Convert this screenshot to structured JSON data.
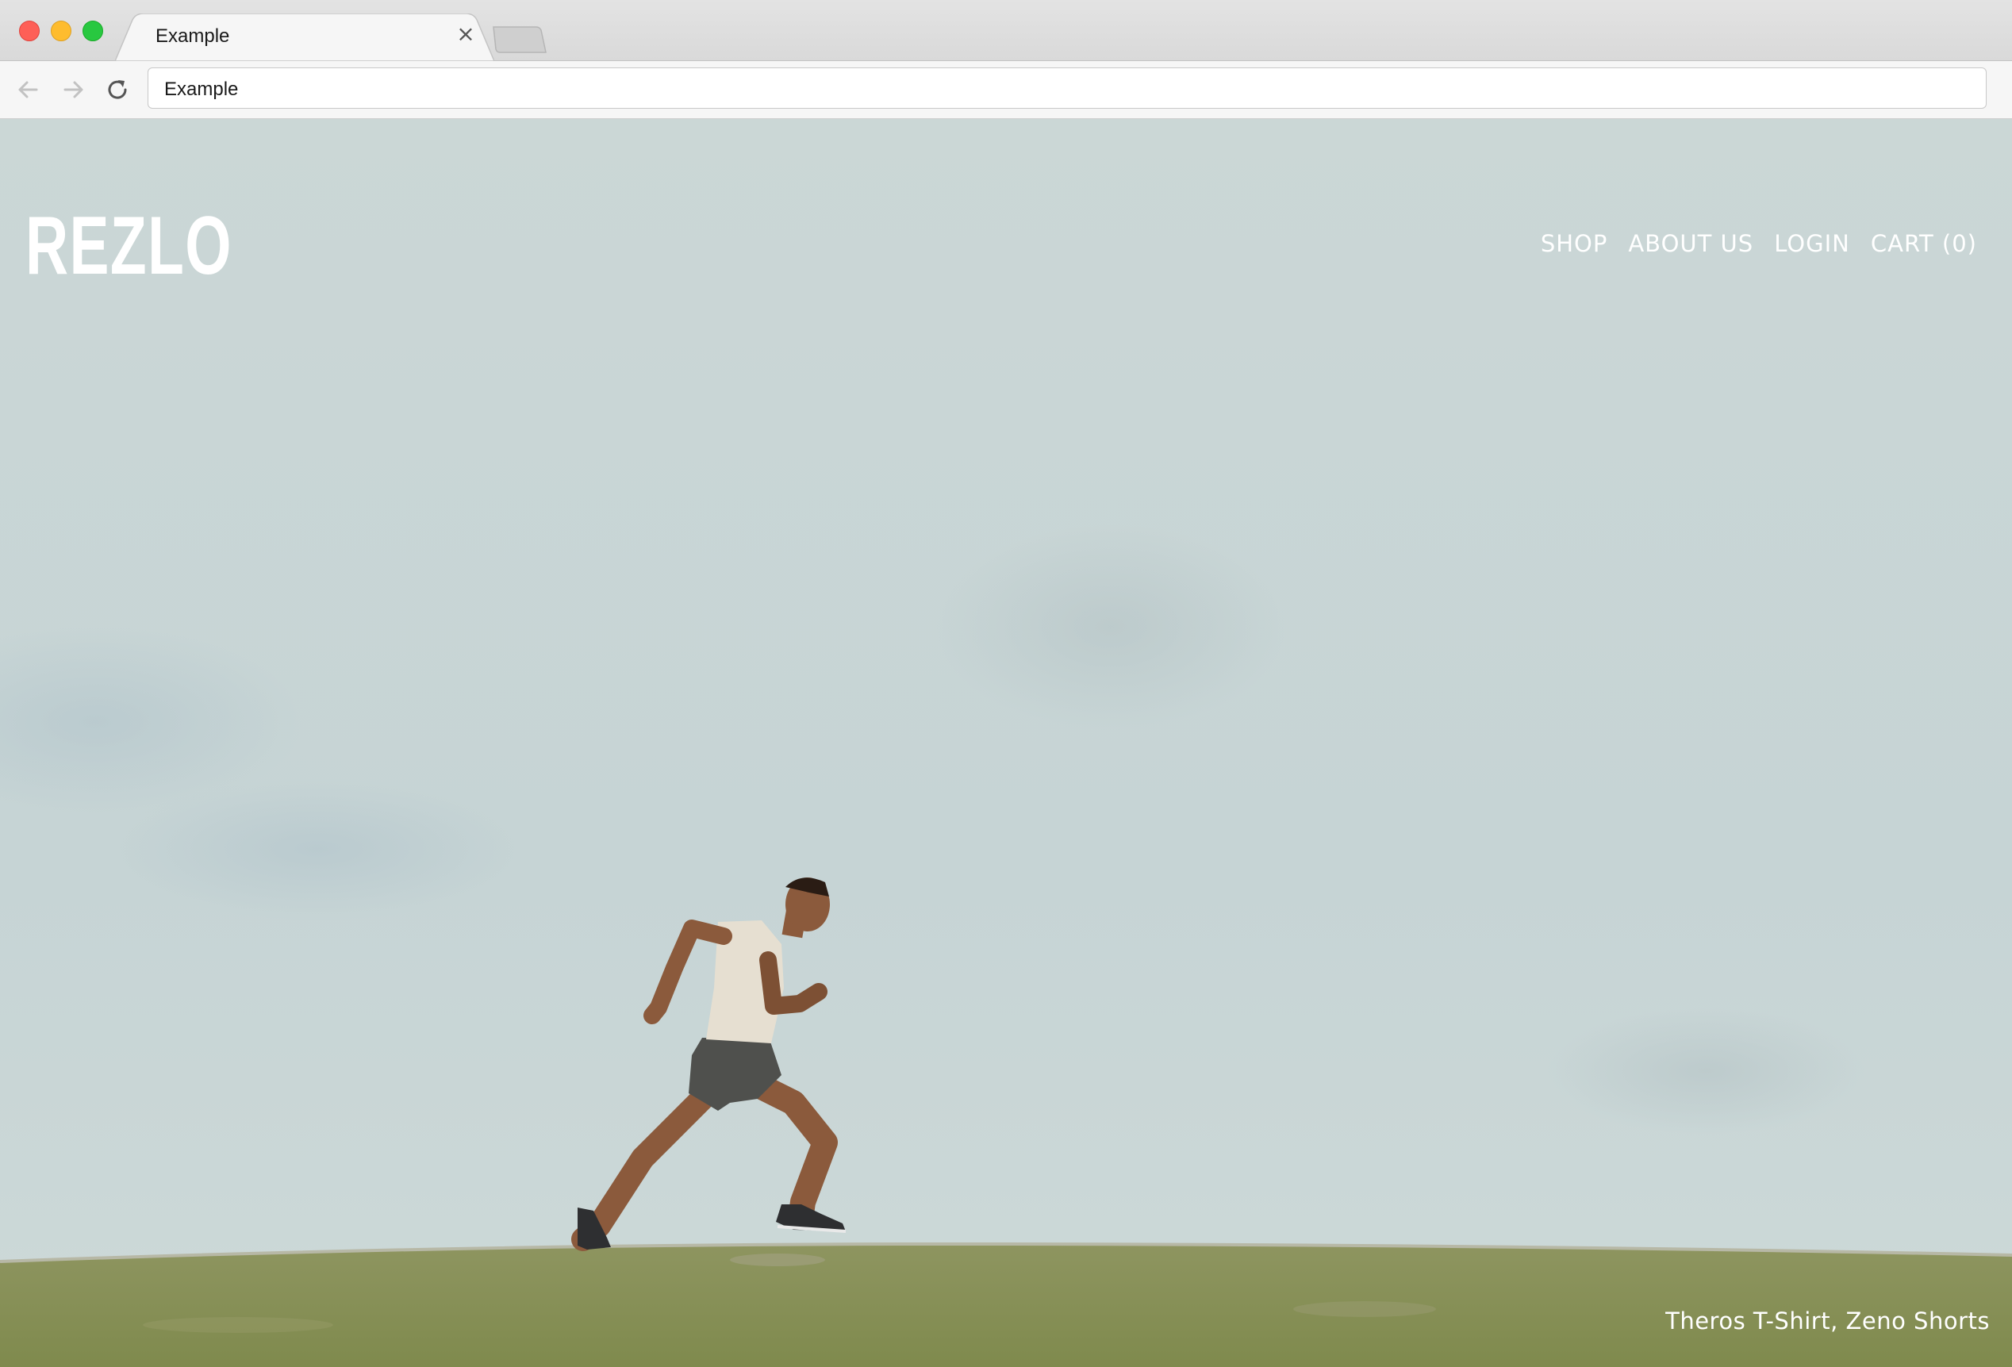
{
  "browser": {
    "tab_title": "Example",
    "close_glyph": "×",
    "address": "Example",
    "icons": {
      "back": "arrow-left-icon",
      "forward": "arrow-right-icon",
      "reload": "reload-icon"
    }
  },
  "site": {
    "logo": "REZLO",
    "nav": {
      "shop": "SHOP",
      "about": "ABOUT US",
      "login": "LOGIN",
      "cart": "CART (0)"
    },
    "hero_caption": "Theros T-Shirt, Zeno Shorts",
    "colors": {
      "sky": "#c9d6d6",
      "grass": "#8d9357",
      "text": "#ffffff"
    }
  }
}
